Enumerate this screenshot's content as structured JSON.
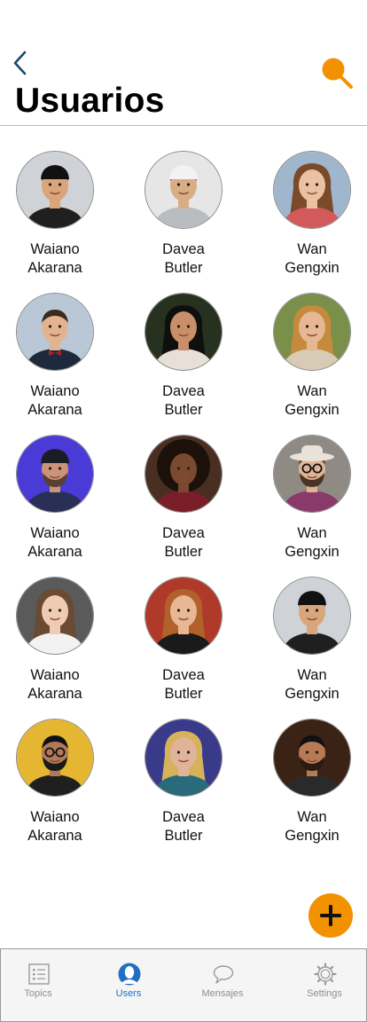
{
  "header": {
    "title": "Usuarios",
    "back_icon": "chevron-left-icon",
    "search_icon": "search-icon",
    "accent_color": "#f39200",
    "back_color": "#1b4a6b"
  },
  "users": [
    {
      "first": "Waiano",
      "last": "Akarana",
      "avatar": "photo-man-black-cap"
    },
    {
      "first": "Davea",
      "last": "Butler",
      "avatar": "photo-man-white-cap-smiling"
    },
    {
      "first": "Wan",
      "last": "Gengxin",
      "avatar": "photo-woman-laughing"
    },
    {
      "first": "Waiano",
      "last": "Akarana",
      "avatar": "photo-man-suit-bowtie"
    },
    {
      "first": "Davea",
      "last": "Butler",
      "avatar": "photo-woman-dark-hair"
    },
    {
      "first": "Wan",
      "last": "Gengxin",
      "avatar": "photo-woman-curly-blonde"
    },
    {
      "first": "Waiano",
      "last": "Akarana",
      "avatar": "photo-man-beanie-neon"
    },
    {
      "first": "Davea",
      "last": "Butler",
      "avatar": "photo-woman-curly-afro"
    },
    {
      "first": "Wan",
      "last": "Gengxin",
      "avatar": "photo-man-hat-glasses"
    },
    {
      "first": "Waiano",
      "last": "Akarana",
      "avatar": "photo-woman-long-hair"
    },
    {
      "first": "Davea",
      "last": "Butler",
      "avatar": "photo-person-red-hair"
    },
    {
      "first": "Wan",
      "last": "Gengxin",
      "avatar": "photo-man-black-cap"
    },
    {
      "first": "Waiano",
      "last": "Akarana",
      "avatar": "photo-man-glasses-yellow"
    },
    {
      "first": "Davea",
      "last": "Butler",
      "avatar": "photo-woman-neon-lights"
    },
    {
      "first": "Wan",
      "last": "Gengxin",
      "avatar": "photo-man-smiling-dark"
    }
  ],
  "fab": {
    "icon": "plus-icon",
    "color": "#f39200"
  },
  "tabs": [
    {
      "label": "Topics",
      "icon": "list-icon",
      "active": false
    },
    {
      "label": "Users",
      "icon": "user-icon",
      "active": true
    },
    {
      "label": "Mensajes",
      "icon": "chat-bubble-icon",
      "active": false
    },
    {
      "label": "Settings",
      "icon": "gear-icon",
      "active": false
    }
  ],
  "tab_active_color": "#1f6fc2",
  "tab_inactive_color": "#8e8e8e"
}
